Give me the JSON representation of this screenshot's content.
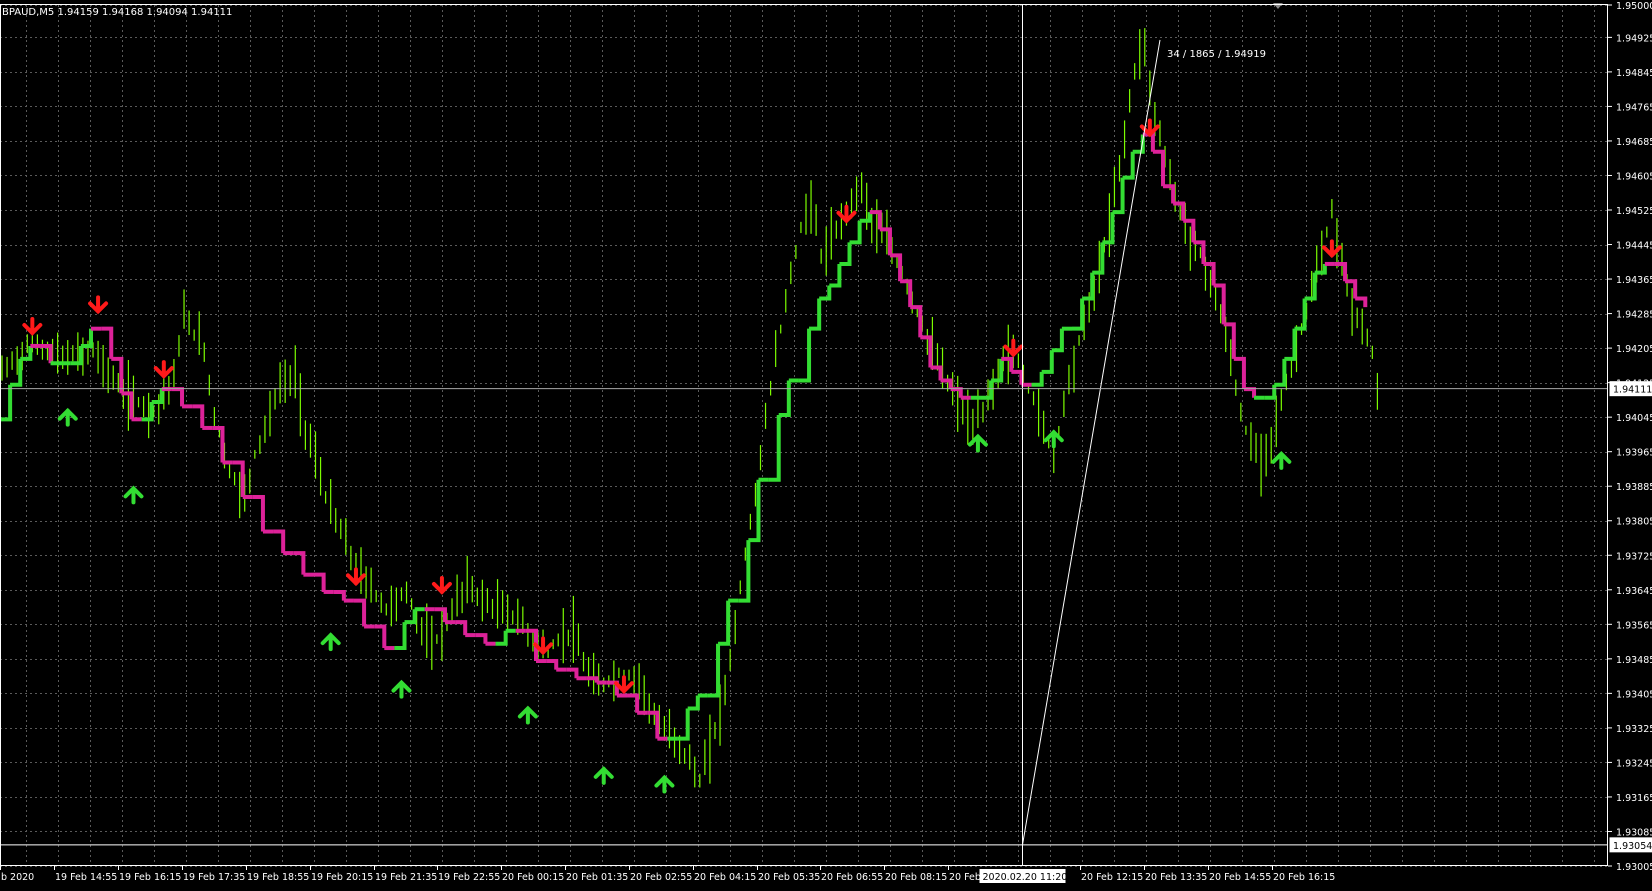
{
  "chart_data": {
    "type": "line",
    "symbol_header": "BPAUD,M5  1.94159 1.94168 1.94094 1.94111",
    "crosshair_readout": "34 / 1865 / 1.94919",
    "price_axis": {
      "ticks": [
        "1.95000",
        "1.94925",
        "1.94845",
        "1.94765",
        "1.94685",
        "1.94605",
        "1.94525",
        "1.94445",
        "1.94365",
        "1.94285",
        "1.94205",
        "1.94125",
        "1.94045",
        "1.93965",
        "1.93885",
        "1.93805",
        "1.93725",
        "1.93645",
        "1.93565",
        "1.93485",
        "1.93405",
        "1.93325",
        "1.93245",
        "1.93165",
        "1.93085",
        "1.93005"
      ],
      "current_price_label": "1.94111",
      "crosshair_price_label": "1.93054",
      "ylim": [
        1.93005,
        1.95
      ]
    },
    "time_axis": {
      "labels": [
        "b 2020",
        "19 Feb 14:55",
        "19 Feb 16:15",
        "19 Feb 17:35",
        "19 Feb 18:55",
        "19 Feb 20:15",
        "19 Feb 21:35",
        "19 Feb 22:55",
        "20 Feb 00:15",
        "20 Feb 01:35",
        "20 Feb 02:55",
        "20 Feb 04:15",
        "20 Feb 05:35",
        "20 Feb 06:55",
        "20 Feb 08:15",
        "20 Feb 09:",
        "20 Feb 12:15",
        "20 Feb 13:35",
        "20 Feb 14:55",
        "20 Feb 16:15"
      ],
      "crosshair_time_label": "2020.02.20 11:20"
    },
    "grid": true,
    "colors": {
      "background": "#000000",
      "grid": "#5a5a5a",
      "price_bars": "#7CFC00",
      "trend_up": "#33DD33",
      "trend_down": "#DD2299",
      "arrow_sell": "#FF1A1A",
      "arrow_buy": "#33DD33",
      "axis_text": "#FFFFFF"
    },
    "price_series": [
      [
        0,
        1.9415
      ],
      [
        6,
        1.9422
      ],
      [
        12,
        1.9418
      ],
      [
        18,
        1.942
      ],
      [
        24,
        1.941
      ],
      [
        30,
        1.9406
      ],
      [
        34,
        1.9414
      ],
      [
        36,
        1.9428
      ],
      [
        40,
        1.942
      ],
      [
        42,
        1.9405
      ],
      [
        45,
        1.9392
      ],
      [
        48,
        1.9386
      ],
      [
        50,
        1.9396
      ],
      [
        53,
        1.9405
      ],
      [
        55,
        1.9412
      ],
      [
        58,
        1.9414
      ],
      [
        60,
        1.9402
      ],
      [
        62,
        1.9395
      ],
      [
        64,
        1.9386
      ],
      [
        67,
        1.9378
      ],
      [
        70,
        1.937
      ],
      [
        73,
        1.9365
      ],
      [
        76,
        1.936
      ],
      [
        80,
        1.9364
      ],
      [
        82,
        1.9358
      ],
      [
        85,
        1.9351
      ],
      [
        88,
        1.9357
      ],
      [
        90,
        1.9362
      ],
      [
        92,
        1.9366
      ],
      [
        95,
        1.9362
      ],
      [
        98,
        1.936
      ],
      [
        102,
        1.9358
      ],
      [
        105,
        1.9353
      ],
      [
        108,
        1.935
      ],
      [
        110,
        1.9353
      ],
      [
        113,
        1.9355
      ],
      [
        115,
        1.9347
      ],
      [
        118,
        1.9342
      ],
      [
        122,
        1.9345
      ],
      [
        126,
        1.9344
      ],
      [
        128,
        1.9338
      ],
      [
        130,
        1.9333
      ],
      [
        133,
        1.933
      ],
      [
        136,
        1.9325
      ],
      [
        138,
        1.932
      ],
      [
        140,
        1.9328
      ],
      [
        142,
        1.9336
      ],
      [
        144,
        1.9348
      ],
      [
        146,
        1.9365
      ],
      [
        148,
        1.938
      ],
      [
        150,
        1.9395
      ],
      [
        152,
        1.9412
      ],
      [
        154,
        1.9425
      ],
      [
        156,
        1.9438
      ],
      [
        158,
        1.9448
      ],
      [
        160,
        1.9455
      ],
      [
        162,
        1.9442
      ],
      [
        164,
        1.9445
      ],
      [
        166,
        1.945
      ],
      [
        168,
        1.9455
      ],
      [
        170,
        1.9458
      ],
      [
        172,
        1.945
      ],
      [
        174,
        1.9447
      ],
      [
        176,
        1.9443
      ],
      [
        178,
        1.9438
      ],
      [
        180,
        1.9432
      ],
      [
        182,
        1.9426
      ],
      [
        184,
        1.942
      ],
      [
        186,
        1.9415
      ],
      [
        188,
        1.941
      ],
      [
        190,
        1.9406
      ],
      [
        192,
        1.9402
      ],
      [
        194,
        1.9406
      ],
      [
        196,
        1.9412
      ],
      [
        198,
        1.9418
      ],
      [
        200,
        1.942
      ],
      [
        202,
        1.9414
      ],
      [
        204,
        1.9409
      ],
      [
        206,
        1.9402
      ],
      [
        208,
        1.9395
      ],
      [
        210,
        1.9408
      ],
      [
        212,
        1.9418
      ],
      [
        214,
        1.9426
      ],
      [
        216,
        1.9434
      ],
      [
        218,
        1.9444
      ],
      [
        220,
        1.9456
      ],
      [
        222,
        1.947
      ],
      [
        224,
        1.9485
      ],
      [
        226,
        1.9492
      ],
      [
        227,
        1.948
      ],
      [
        229,
        1.947
      ],
      [
        231,
        1.946
      ],
      [
        233,
        1.9452
      ],
      [
        235,
        1.9446
      ],
      [
        237,
        1.9442
      ],
      [
        239,
        1.9436
      ],
      [
        241,
        1.9428
      ],
      [
        243,
        1.9418
      ],
      [
        245,
        1.9405
      ],
      [
        247,
        1.9398
      ],
      [
        249,
        1.9395
      ],
      [
        251,
        1.94
      ],
      [
        253,
        1.9408
      ],
      [
        255,
        1.9416
      ],
      [
        257,
        1.9425
      ],
      [
        259,
        1.9434
      ],
      [
        261,
        1.9442
      ],
      [
        263,
        1.9452
      ],
      [
        265,
        1.944
      ],
      [
        267,
        1.943
      ],
      [
        269,
        1.9425
      ],
      [
        271,
        1.942
      ],
      [
        272,
        1.941
      ]
    ],
    "trend_series": [
      [
        0,
        1.9404,
        "up"
      ],
      [
        2,
        1.9412,
        "up"
      ],
      [
        4,
        1.9418,
        "up"
      ],
      [
        6,
        1.9421,
        "down"
      ],
      [
        8,
        1.9421,
        "down"
      ],
      [
        10,
        1.9417,
        "up"
      ],
      [
        14,
        1.9417,
        "up"
      ],
      [
        16,
        1.9421,
        "up"
      ],
      [
        18,
        1.9425,
        "down"
      ],
      [
        20,
        1.9425,
        "down"
      ],
      [
        22,
        1.9418,
        "down"
      ],
      [
        24,
        1.941,
        "down"
      ],
      [
        26,
        1.9404,
        "down"
      ],
      [
        28,
        1.9404,
        "up"
      ],
      [
        30,
        1.9408,
        "up"
      ],
      [
        32,
        1.9411,
        "down"
      ],
      [
        34,
        1.9411,
        "down"
      ],
      [
        36,
        1.9407,
        "down"
      ],
      [
        38,
        1.9407,
        "down"
      ],
      [
        40,
        1.9402,
        "down"
      ],
      [
        42,
        1.9402,
        "down"
      ],
      [
        44,
        1.9394,
        "down"
      ],
      [
        46,
        1.9394,
        "down"
      ],
      [
        48,
        1.9386,
        "down"
      ],
      [
        50,
        1.9386,
        "down"
      ],
      [
        52,
        1.9378,
        "down"
      ],
      [
        54,
        1.9378,
        "down"
      ],
      [
        56,
        1.9373,
        "down"
      ],
      [
        58,
        1.9373,
        "down"
      ],
      [
        60,
        1.9368,
        "down"
      ],
      [
        62,
        1.9368,
        "down"
      ],
      [
        64,
        1.9364,
        "down"
      ],
      [
        66,
        1.9364,
        "down"
      ],
      [
        68,
        1.9362,
        "down"
      ],
      [
        70,
        1.9362,
        "down"
      ],
      [
        72,
        1.9356,
        "down"
      ],
      [
        74,
        1.9356,
        "down"
      ],
      [
        76,
        1.9351,
        "down"
      ],
      [
        78,
        1.9351,
        "up"
      ],
      [
        80,
        1.9357,
        "up"
      ],
      [
        82,
        1.936,
        "up"
      ],
      [
        84,
        1.936,
        "down"
      ],
      [
        86,
        1.936,
        "down"
      ],
      [
        88,
        1.9357,
        "down"
      ],
      [
        90,
        1.9357,
        "down"
      ],
      [
        92,
        1.9354,
        "down"
      ],
      [
        94,
        1.9354,
        "down"
      ],
      [
        96,
        1.9352,
        "down"
      ],
      [
        98,
        1.9352,
        "up"
      ],
      [
        100,
        1.9355,
        "up"
      ],
      [
        102,
        1.9355,
        "down"
      ],
      [
        104,
        1.9355,
        "down"
      ],
      [
        106,
        1.9348,
        "down"
      ],
      [
        108,
        1.9348,
        "down"
      ],
      [
        110,
        1.9346,
        "down"
      ],
      [
        112,
        1.9346,
        "down"
      ],
      [
        114,
        1.9344,
        "down"
      ],
      [
        116,
        1.9344,
        "down"
      ],
      [
        118,
        1.9343,
        "down"
      ],
      [
        120,
        1.9343,
        "down"
      ],
      [
        122,
        1.934,
        "down"
      ],
      [
        124,
        1.934,
        "down"
      ],
      [
        126,
        1.9336,
        "down"
      ],
      [
        128,
        1.9336,
        "down"
      ],
      [
        130,
        1.933,
        "down"
      ],
      [
        132,
        1.933,
        "up"
      ],
      [
        134,
        1.933,
        "up"
      ],
      [
        136,
        1.9337,
        "up"
      ],
      [
        138,
        1.934,
        "up"
      ],
      [
        140,
        1.934,
        "up"
      ],
      [
        142,
        1.9352,
        "up"
      ],
      [
        144,
        1.9362,
        "up"
      ],
      [
        146,
        1.9362,
        "up"
      ],
      [
        148,
        1.9376,
        "up"
      ],
      [
        150,
        1.939,
        "up"
      ],
      [
        152,
        1.939,
        "up"
      ],
      [
        154,
        1.9405,
        "up"
      ],
      [
        156,
        1.9413,
        "up"
      ],
      [
        158,
        1.9413,
        "up"
      ],
      [
        160,
        1.9425,
        "up"
      ],
      [
        162,
        1.9432,
        "up"
      ],
      [
        164,
        1.9435,
        "up"
      ],
      [
        166,
        1.944,
        "up"
      ],
      [
        168,
        1.9445,
        "up"
      ],
      [
        170,
        1.945,
        "up"
      ],
      [
        172,
        1.9452,
        "down"
      ],
      [
        174,
        1.9448,
        "down"
      ],
      [
        176,
        1.9442,
        "down"
      ],
      [
        178,
        1.9436,
        "down"
      ],
      [
        180,
        1.943,
        "down"
      ],
      [
        182,
        1.9423,
        "down"
      ],
      [
        184,
        1.9416,
        "down"
      ],
      [
        186,
        1.9413,
        "down"
      ],
      [
        188,
        1.9411,
        "down"
      ],
      [
        190,
        1.9409,
        "down"
      ],
      [
        192,
        1.9409,
        "up"
      ],
      [
        194,
        1.9409,
        "up"
      ],
      [
        196,
        1.9413,
        "up"
      ],
      [
        198,
        1.9418,
        "down"
      ],
      [
        200,
        1.9415,
        "down"
      ],
      [
        202,
        1.9412,
        "down"
      ],
      [
        204,
        1.9412,
        "up"
      ],
      [
        206,
        1.9415,
        "up"
      ],
      [
        208,
        1.942,
        "up"
      ],
      [
        210,
        1.9425,
        "up"
      ],
      [
        212,
        1.9425,
        "up"
      ],
      [
        214,
        1.9432,
        "up"
      ],
      [
        216,
        1.9438,
        "up"
      ],
      [
        218,
        1.9445,
        "up"
      ],
      [
        220,
        1.9452,
        "up"
      ],
      [
        222,
        1.946,
        "up"
      ],
      [
        224,
        1.9466,
        "up"
      ],
      [
        226,
        1.947,
        "down"
      ],
      [
        228,
        1.9466,
        "down"
      ],
      [
        230,
        1.9458,
        "down"
      ],
      [
        232,
        1.9454,
        "down"
      ],
      [
        234,
        1.945,
        "down"
      ],
      [
        236,
        1.9445,
        "down"
      ],
      [
        238,
        1.944,
        "down"
      ],
      [
        240,
        1.9435,
        "down"
      ],
      [
        242,
        1.9426,
        "down"
      ],
      [
        244,
        1.9418,
        "down"
      ],
      [
        246,
        1.9411,
        "down"
      ],
      [
        248,
        1.9409,
        "up"
      ],
      [
        250,
        1.9409,
        "up"
      ],
      [
        252,
        1.9412,
        "up"
      ],
      [
        254,
        1.9418,
        "up"
      ],
      [
        256,
        1.9425,
        "up"
      ],
      [
        258,
        1.9432,
        "up"
      ],
      [
        260,
        1.9438,
        "up"
      ],
      [
        262,
        1.944,
        "down"
      ],
      [
        264,
        1.944,
        "down"
      ],
      [
        266,
        1.9436,
        "down"
      ],
      [
        268,
        1.9432,
        "down"
      ],
      [
        270,
        1.943,
        "down"
      ]
    ],
    "sell_arrows": [
      [
        6,
        1.942
      ],
      [
        19,
        1.9425
      ],
      [
        32,
        1.941
      ],
      [
        70,
        1.9362
      ],
      [
        87,
        1.936
      ],
      [
        107,
        1.9346
      ],
      [
        123,
        1.9337
      ],
      [
        167,
        1.9446
      ],
      [
        200,
        1.9415
      ],
      [
        227,
        1.9466
      ],
      [
        263,
        1.9438
      ]
    ],
    "buy_arrows": [
      [
        13,
        1.941
      ],
      [
        26,
        1.9392
      ],
      [
        65,
        1.9358
      ],
      [
        79,
        1.9347
      ],
      [
        104,
        1.9341
      ],
      [
        119,
        1.9327
      ],
      [
        131,
        1.9325
      ],
      [
        193,
        1.9404
      ],
      [
        208,
        1.9405
      ],
      [
        253,
        1.94
      ]
    ]
  }
}
